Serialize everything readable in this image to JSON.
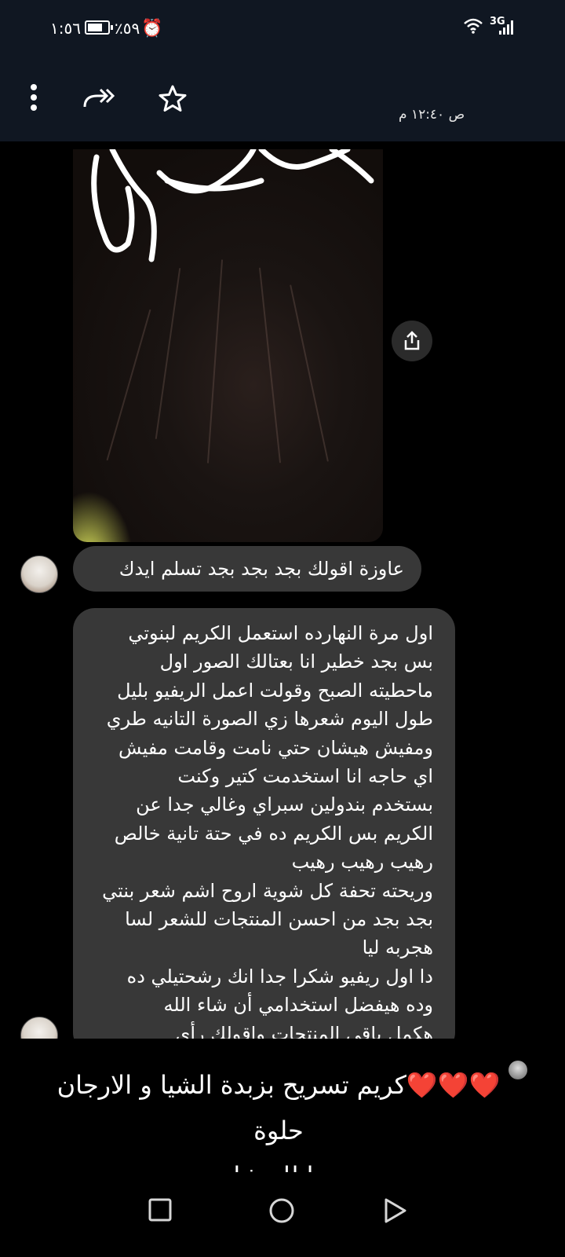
{
  "status_bar": {
    "time": "١:٥٦",
    "battery_pct": "٪٥٩",
    "alarm_icon": "alarm-icon",
    "wifi_icon": "wifi-icon",
    "network": "3G"
  },
  "header": {
    "menu_icon": "more-vert-icon",
    "forward_icon": "forward-all-icon",
    "star_icon": "star-icon",
    "timestamp": "ص ١٢:٤٠ م"
  },
  "image_message": {
    "share_icon": "share-icon"
  },
  "messages": [
    {
      "text": "عاوزة اقولك بجد بجد بجد تسلم ايدك"
    },
    {
      "lines": [
        "اول مرة النهارده استعمل الكريم لبنوتي",
        "بس بجد خطير انا بعتالك الصور اول",
        "ماحطيته الصبح وقولت اعمل الريفيو بليل",
        "طول اليوم شعرها زي الصورة التانيه طري",
        "ومفيش هيشان حتي نامت وقامت مفيش",
        "اي حاجه انا استخدمت كتير وكنت",
        "بستخدم بندولين سبراي وغالي جدا عن",
        "الكريم بس الكريم ده في حتة تانية خالص",
        "رهيب رهيب رهيب",
        "وريحته تحفة كل شوية اروح اشم شعر بنتي",
        "بجد بجد من احسن المنتجات للشعر لسا",
        "هجربه ليا",
        "دا اول ريفيو شكرا جدا انك رشحتيلي ده",
        "وده هيفضل استخدامي أن شاء الله",
        "هكمل باقي المنتجات واقولك رأي"
      ]
    }
  ],
  "comment_overlay": {
    "hearts": "❤️❤️❤️",
    "text_line1": "كريم تسريح بزبدة الشيا و الارجان حلوة",
    "text_line2": "جدا للهيشان"
  },
  "nav_bar": {
    "recents_icon": "square-icon",
    "home_icon": "circle-icon",
    "back_icon": "triangle-back-icon"
  }
}
